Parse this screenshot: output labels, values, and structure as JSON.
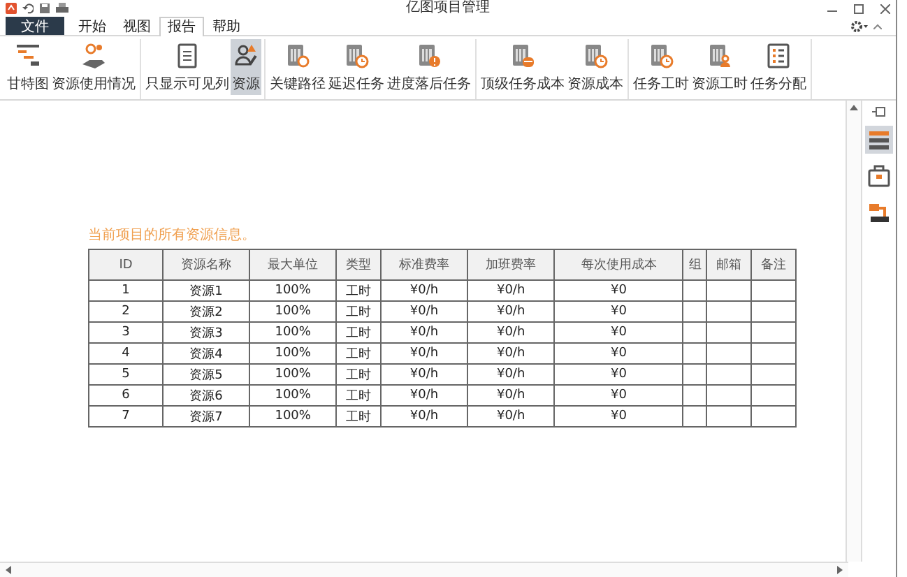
{
  "window": {
    "title": "亿图项目管理"
  },
  "tabs": [
    {
      "label": "文件",
      "kind": "file",
      "selected": false
    },
    {
      "label": "开始",
      "kind": "tab",
      "selected": false
    },
    {
      "label": "视图",
      "kind": "tab",
      "selected": false
    },
    {
      "label": "报告",
      "kind": "tab",
      "selected": true
    },
    {
      "label": "帮助",
      "kind": "tab",
      "selected": false
    }
  ],
  "ribbon": {
    "groups": [
      {
        "buttons": [
          {
            "label": "甘特图",
            "kind": "gantt",
            "selected": false
          },
          {
            "label": "资源使用情况",
            "kind": "people",
            "selected": false
          }
        ]
      },
      {
        "buttons": [
          {
            "label": "只显示可见列",
            "kind": "list-doc",
            "selected": false
          },
          {
            "label": "资源",
            "kind": "person",
            "selected": true
          }
        ]
      },
      {
        "buttons": [
          {
            "label": "关键路径",
            "kind": "doc-ring",
            "selected": false
          },
          {
            "label": "延迟任务",
            "kind": "doc-clock",
            "selected": false
          },
          {
            "label": "进度落后任务",
            "kind": "doc-alert",
            "selected": false
          }
        ]
      },
      {
        "buttons": [
          {
            "label": "顶级任务成本",
            "kind": "doc-coin",
            "selected": false
          },
          {
            "label": "资源成本",
            "kind": "doc-clock",
            "selected": false
          }
        ]
      },
      {
        "buttons": [
          {
            "label": "任务工时",
            "kind": "doc-clock",
            "selected": false
          },
          {
            "label": "资源工时",
            "kind": "doc-person",
            "selected": false
          },
          {
            "label": "任务分配",
            "kind": "checklist",
            "selected": false
          }
        ]
      }
    ]
  },
  "report": {
    "heading": "当前项目的所有资源信息。",
    "columns": [
      "ID",
      "资源名称",
      "最大单位",
      "类型",
      "标准费率",
      "加班费率",
      "每次使用成本",
      "组",
      "邮箱",
      "备注"
    ],
    "rows": [
      [
        "1",
        "资源1",
        "100%",
        "工时",
        "¥0/h",
        "¥0/h",
        "¥0"
      ],
      [
        "2",
        "资源2",
        "100%",
        "工时",
        "¥0/h",
        "¥0/h",
        "¥0"
      ],
      [
        "3",
        "资源3",
        "100%",
        "工时",
        "¥0/h",
        "¥0/h",
        "¥0"
      ],
      [
        "4",
        "资源4",
        "100%",
        "工时",
        "¥0/h",
        "¥0/h",
        "¥0"
      ],
      [
        "5",
        "资源5",
        "100%",
        "工时",
        "¥0/h",
        "¥0/h",
        "¥0"
      ],
      [
        "6",
        "资源6",
        "100%",
        "工时",
        "¥0/h",
        "¥0/h",
        "¥0"
      ],
      [
        "7",
        "资源7",
        "100%",
        "工时",
        "¥0/h",
        "¥0/h",
        "¥0"
      ]
    ]
  },
  "side_panel": {
    "items": [
      {
        "kind": "list",
        "selected": true
      },
      {
        "kind": "briefcase",
        "selected": false
      },
      {
        "kind": "transfer",
        "selected": false
      }
    ]
  }
}
